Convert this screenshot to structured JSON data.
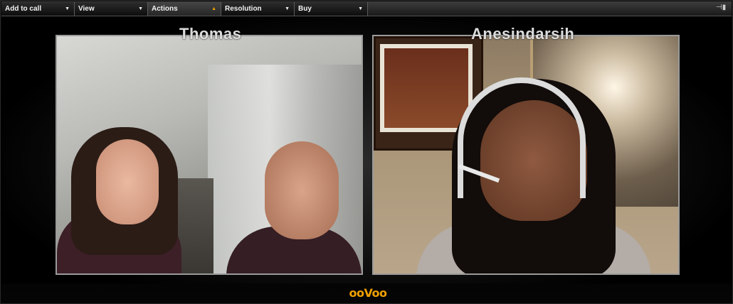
{
  "menubar": {
    "items": [
      {
        "label": "Add to call",
        "active": false
      },
      {
        "label": "View",
        "active": false
      },
      {
        "label": "Actions",
        "active": true
      },
      {
        "label": "Resolution",
        "active": false
      },
      {
        "label": "Buy",
        "active": false
      }
    ],
    "arrow_down": "▼",
    "arrow_up": "▲",
    "pin_glyph": "⊣▮"
  },
  "video": {
    "participants": [
      {
        "name": "Thomas"
      },
      {
        "name": "Anesindarsih"
      }
    ]
  },
  "logo": {
    "text": "ooVoo",
    "color": "#f0a000"
  }
}
